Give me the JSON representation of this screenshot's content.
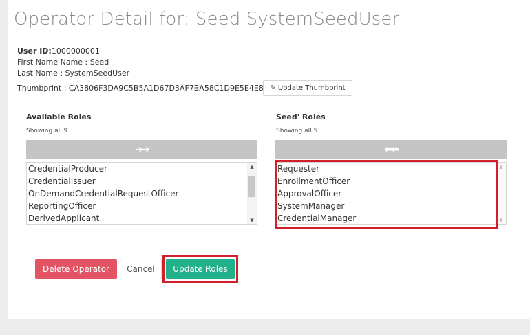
{
  "page": {
    "title": "Operator Detail for: Seed SystemSeedUser"
  },
  "operator": {
    "user_id_label": "User ID:",
    "user_id_value": "1000000001",
    "first_name_line": "First Name Name : Seed",
    "last_name_line": "Last Name : SystemSeedUser",
    "thumbprint_line": "Thumbprint : CA3806F3DA9C5B5A1D67D3AF7BA58C1D9E5E4E83",
    "update_thumbprint_label": "Update Thumbprint"
  },
  "available_roles": {
    "title": "Available Roles",
    "count_text": "Showing all 9",
    "move_label": "➔➔",
    "items": [
      "CredentialProducer",
      "CredentialIssuer",
      "OnDemandCredentialRequestOfficer",
      "ReportingOfficer",
      "DerivedApplicant"
    ],
    "scroll_fraction": 0.0
  },
  "seed_roles": {
    "title": "Seed' Roles",
    "count_text": "Showing all 5",
    "move_label": "⬅⬅",
    "items": [
      "Requester",
      "EnrollmentOfficer",
      "ApprovalOfficer",
      "SystemManager",
      "CredentialManager"
    ]
  },
  "actions": {
    "delete_label": "Delete Operator",
    "cancel_label": "Cancel",
    "update_label": "Update Roles"
  },
  "colors": {
    "delete": "#e25463",
    "update": "#21b08c",
    "highlight": "#d0202a"
  }
}
